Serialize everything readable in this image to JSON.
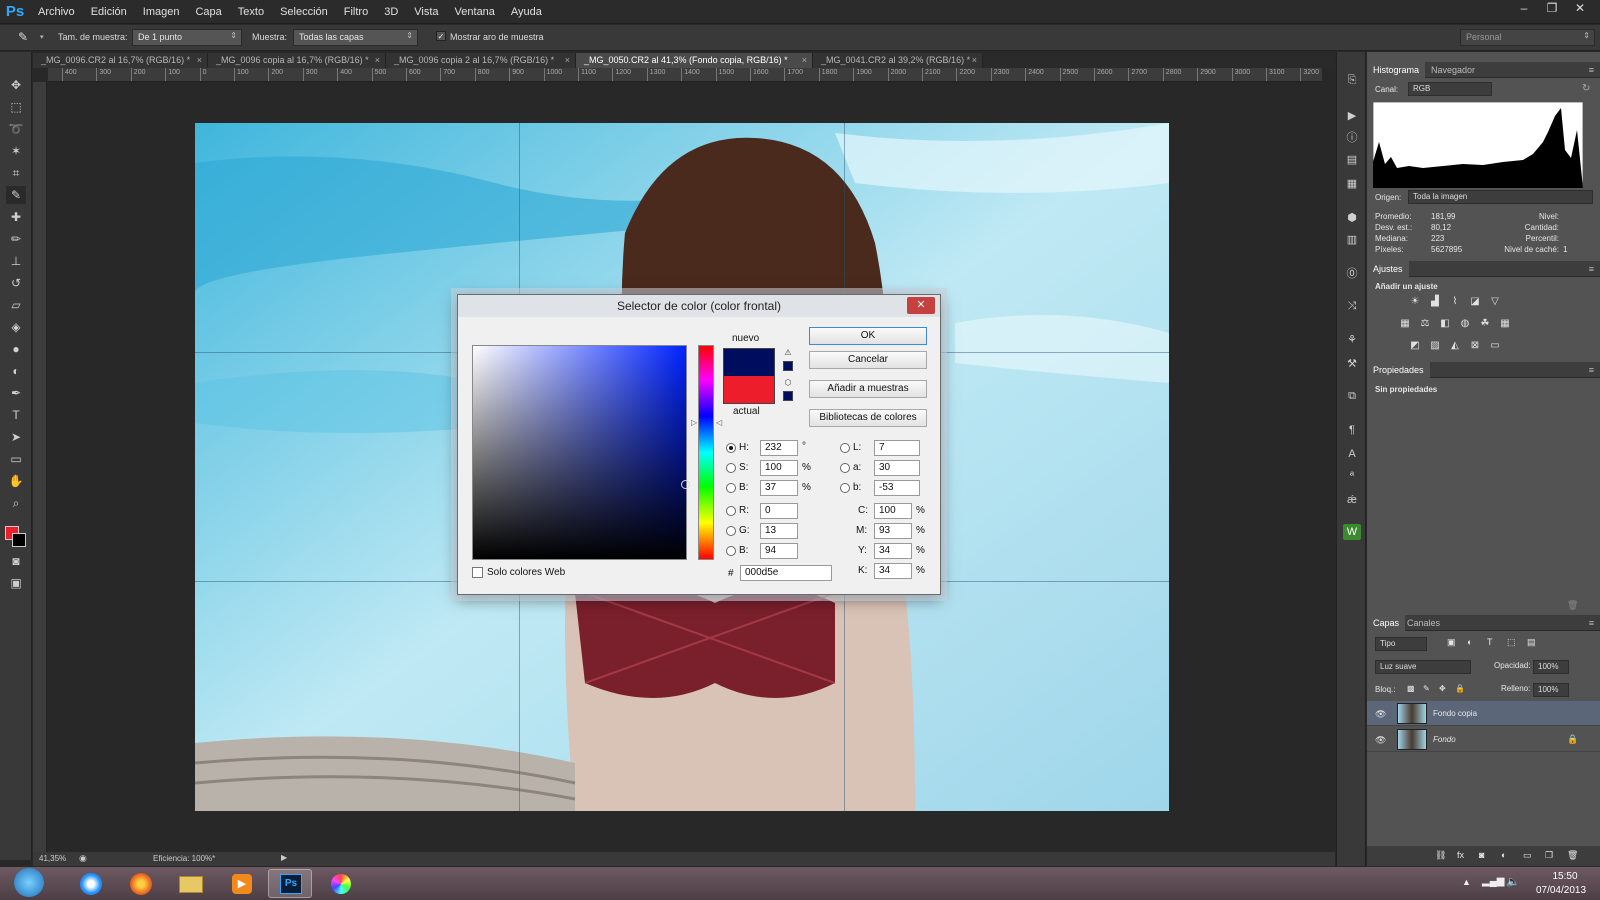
{
  "app": {
    "logo": "Ps"
  },
  "menu": [
    "Archivo",
    "Edición",
    "Imagen",
    "Capa",
    "Texto",
    "Selección",
    "Filtro",
    "3D",
    "Vista",
    "Ventana",
    "Ayuda"
  ],
  "window_buttons": {
    "minimize": "–",
    "restore": "❐",
    "close": "✕"
  },
  "options_bar": {
    "sample_size_label": "Tam. de muestra:",
    "sample_size_value": "De 1 punto",
    "sample_label": "Muestra:",
    "sample_value": "Todas las capas",
    "show_ring_label": "Mostrar aro de muestra",
    "workspace_value": "Personal"
  },
  "doc_tabs": [
    {
      "label": "_MG_0096.CR2 al 16,7% (RGB/16) *"
    },
    {
      "label": "_MG_0096 copia al 16,7% (RGB/16) *"
    },
    {
      "label": "_MG_0096 copia 2 al 16,7% (RGB/16) *"
    },
    {
      "label": "_MG_0050.CR2 al 41,3% (Fondo copia, RGB/16) *"
    },
    {
      "label": "_MG_0041.CR2 al 39,2% (RGB/16) *"
    }
  ],
  "ruler_h": [
    "400",
    "300",
    "200",
    "100",
    "0",
    "100",
    "200",
    "300",
    "400",
    "500",
    "600",
    "700",
    "800",
    "900",
    "1000",
    "1100",
    "1200",
    "1300",
    "1400",
    "1500",
    "1600",
    "1700",
    "1800",
    "1900",
    "2000",
    "2100",
    "2200",
    "2300",
    "2400",
    "2500",
    "2600",
    "2700",
    "2800",
    "2900",
    "3000",
    "3100",
    "3200"
  ],
  "status": {
    "zoom": "41,35%",
    "efficiency": "Eficiencia: 100%*"
  },
  "dialog": {
    "title": "Selector de color (color frontal)",
    "close": "✕",
    "new_label": "nuevo",
    "current_label": "actual",
    "new_color": "#000d5e",
    "current_color": "#ee1d2b",
    "buttons": {
      "ok": "OK",
      "cancel": "Cancelar",
      "add_swatch": "Añadir a muestras",
      "libraries": "Bibliotecas de colores"
    },
    "hsb": {
      "h_label": "H:",
      "h": "232",
      "h_unit": "°",
      "s_label": "S:",
      "s": "100",
      "s_unit": "%",
      "b_label": "B:",
      "b": "37",
      "b_unit": "%"
    },
    "rgb": {
      "r_label": "R:",
      "r": "0",
      "g_label": "G:",
      "g": "13",
      "b_label": "B:",
      "b": "94"
    },
    "lab": {
      "l_label": "L:",
      "l": "7",
      "a_label": "a:",
      "a": "30",
      "b_label": "b:",
      "b": "-53"
    },
    "cmyk": {
      "c_label": "C:",
      "c": "100",
      "m_label": "M:",
      "m": "93",
      "y_label": "Y:",
      "y": "34",
      "k_label": "K:",
      "k": "34",
      "unit": "%"
    },
    "hex_label": "#",
    "hex": "000d5e",
    "web_only_label": "Solo colores Web"
  },
  "histogram": {
    "tabs": [
      "Histograma",
      "Navegador"
    ],
    "channel_label": "Canal:",
    "channel_value": "RGB",
    "source_label": "Origen:",
    "source_value": "Toda la imagen",
    "stats_left": [
      {
        "label": "Promedio:",
        "value": "181,99"
      },
      {
        "label": "Desv. est.:",
        "value": "80,12"
      },
      {
        "label": "Mediana:",
        "value": "223"
      },
      {
        "label": "Píxeles:",
        "value": "5627895"
      }
    ],
    "stats_right": [
      {
        "label": "Nivel:",
        "value": ""
      },
      {
        "label": "Cantidad:",
        "value": ""
      },
      {
        "label": "Percentil:",
        "value": ""
      },
      {
        "label": "Nivel de caché:",
        "value": "1"
      }
    ]
  },
  "adjustments": {
    "tab": "Ajustes",
    "title": "Añadir un ajuste"
  },
  "properties": {
    "tab": "Propiedades",
    "text": "Sin propiedades"
  },
  "layers": {
    "tabs": [
      "Capas",
      "Canales"
    ],
    "filter_value": "Tipo",
    "blend_value": "Luz suave",
    "opacity_label": "Opacidad:",
    "opacity_value": "100%",
    "lock_label": "Bloq.:",
    "fill_label": "Relleno:",
    "fill_value": "100%",
    "items": [
      {
        "name": "Fondo copia"
      },
      {
        "name": "Fondo"
      }
    ]
  },
  "taskbar": {
    "time": "15:50",
    "date": "07/04/2013"
  }
}
